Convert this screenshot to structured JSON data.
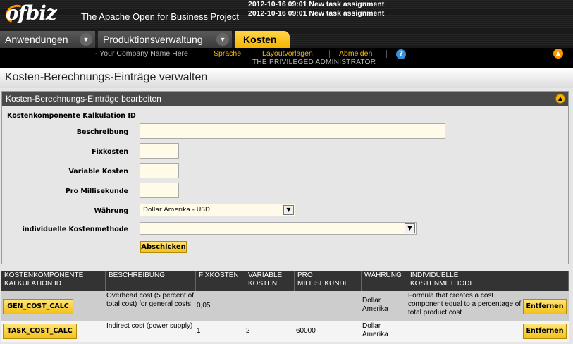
{
  "header": {
    "logo_text": "ofbiz",
    "project_title": "The Apache Open for Business Project",
    "notifications": [
      "2012-10-16 09:01 New task assignment",
      "2012-10-16 09:01 New task assignment"
    ]
  },
  "app_tabs": [
    {
      "label": "Anwendungen"
    },
    {
      "label": "Produktionsverwaltung"
    },
    {
      "label": "Kosten"
    }
  ],
  "userbar": {
    "company": "- Your Company Name Here",
    "language": "Sprache",
    "layouts": "Layoutvorlagen",
    "logout": "Abmelden",
    "user": "THE PRIVILEGED ADMINISTRATOR"
  },
  "page_title": "Kosten-Berechnungs-Einträge verwalten",
  "form": {
    "title": "Kosten-Berechnungs-Einträge bearbeiten",
    "id_label": "Kostenkomponente Kalkulation ID",
    "description_label": "Beschreibung",
    "description_value": "",
    "fixed_label": "Fixkosten",
    "fixed_value": "",
    "variable_label": "Variable Kosten",
    "variable_value": "",
    "per_ms_label": "Pro Millisekunde",
    "per_ms_value": "",
    "currency_label": "Währung",
    "currency_value": "Dollar Amerika - USD",
    "method_label": "individuelle Kostenmethode",
    "method_value": "",
    "submit_label": "Abschicken"
  },
  "table": {
    "headers": [
      "KOSTENKOMPONENTE KALKULATION ID",
      "BESCHREIBUNG",
      "FIXKOSTEN",
      "VARIABLE KOSTEN",
      "PRO MILLISEKUNDE",
      "WÄHRUNG",
      "INDIVIDUELLE KOSTENMETHODE",
      ""
    ],
    "rows": [
      {
        "id": "GEN_COST_CALC",
        "description": "Overhead cost (5 percent of total cost) for general costs",
        "fixed": "0,05",
        "variable": "",
        "per_ms": "",
        "currency": "Dollar Amerika",
        "method": "Formula that creates a cost component equal to a percentage of total product cost",
        "action": "Entfernen"
      },
      {
        "id": "TASK_COST_CALC",
        "description": "Indirect cost (power supply)",
        "fixed": "1",
        "variable": "2",
        "per_ms": "60000",
        "currency": "Dollar Amerika",
        "method": "",
        "action": "Entfernen"
      }
    ]
  }
}
